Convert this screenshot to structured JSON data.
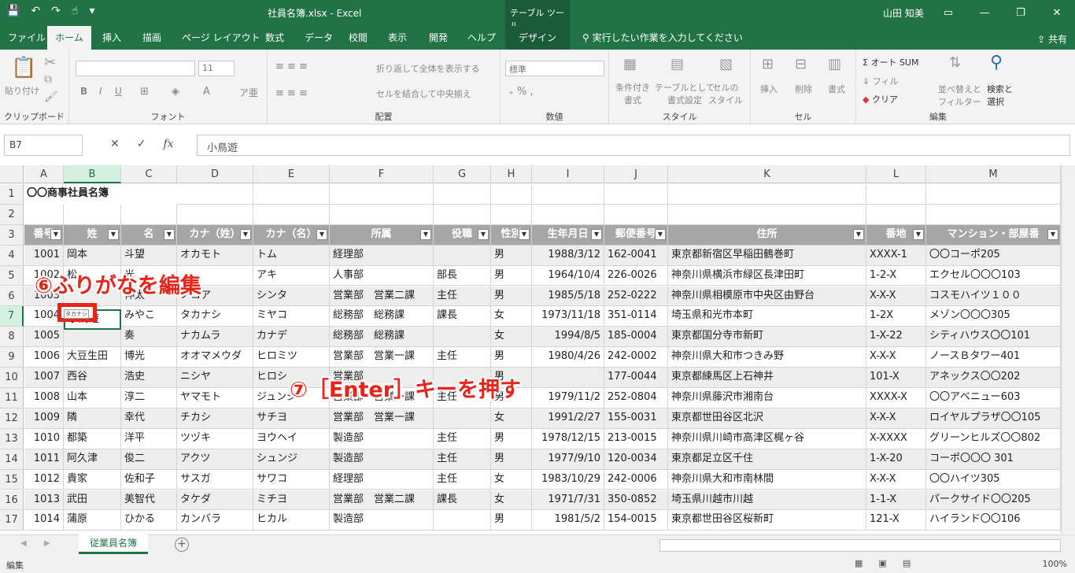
{
  "window": {
    "doc_title": "社員名簿.xlsx  -  Excel",
    "context_title": "テーブル ツール",
    "user": "山田 知美"
  },
  "ribbon_tabs": [
    "ファイル",
    "ホーム",
    "挿入",
    "描画",
    "ページ レイアウト",
    "数式",
    "データ",
    "校閲",
    "表示",
    "開発",
    "ヘルプ",
    "デザイン"
  ],
  "tell_me": "実行したい作業を入力してください",
  "share": "共有",
  "ribbon": {
    "groups": [
      "クリップボード",
      "フォント",
      "配置",
      "数値",
      "スタイル",
      "セル",
      "編集"
    ],
    "paste": "貼り付け",
    "font_size": "11",
    "wrap_text": "折り返して全体を表示する",
    "merge_center": "セルを結合して中央揃え",
    "number_format": "標準",
    "cond_format": "条件付き\n書式",
    "table_format": "テーブルとして\n書式設定",
    "cell_style": "セルの\nスタイル",
    "insert": "挿入",
    "delete": "削除",
    "format": "書式",
    "autosum": "オート SUM",
    "fill": "フィル",
    "clear": "クリア",
    "sort_filter": "並べ替えと\nフィルター",
    "find_select": "検索と\n選択"
  },
  "formula_bar": {
    "name_box": "B7",
    "fx": "fx",
    "content": "小鳥遊"
  },
  "columns": [
    "A",
    "B",
    "C",
    "D",
    "E",
    "F",
    "G",
    "H",
    "I",
    "J",
    "K",
    "L",
    "M"
  ],
  "rows": [
    "1",
    "2",
    "3",
    "4",
    "5",
    "6",
    "7",
    "8",
    "9",
    "10",
    "11",
    "12",
    "13",
    "14",
    "15",
    "16",
    "17"
  ],
  "sheet_title": "〇〇商事社員名簿",
  "table_headers": [
    "番号",
    "姓",
    "名",
    "カナ（姓）",
    "カナ（名）",
    "所属",
    "役職",
    "性別",
    "生年月日",
    "郵便番号",
    "住所",
    "番地",
    "マンション・部屋番"
  ],
  "table_rows": [
    [
      "1001",
      "岡本",
      "斗望",
      "オカモト",
      "トム",
      "経理部",
      "",
      "男",
      "1988/3/12",
      "162-0041",
      "東京都新宿区早稲田鶴巻町",
      "XXXX-1",
      "〇〇コーポ205"
    ],
    [
      "1002",
      "松",
      "光",
      "",
      "アキ",
      "人事部",
      "部長",
      "男",
      "1964/10/4",
      "226-0026",
      "神奈川県横浜市緑区長津田町",
      "1-2-X",
      "エクセル〇〇〇103"
    ],
    [
      "1003",
      "",
      "伸太",
      "ノコア",
      "シンタ",
      "営業部　営業二課",
      "主任",
      "男",
      "1985/5/18",
      "252-0222",
      "神奈川県相模原市中央区由野台",
      "X-X-X",
      "コスモハイツ１００"
    ],
    [
      "1004",
      "",
      "みやこ",
      "タカナシ",
      "ミヤコ",
      "総務部　総務課",
      "課長",
      "女",
      "1973/11/18",
      "351-0114",
      "埼玉県和光市本町",
      "1-2X",
      "メゾン〇〇〇305"
    ],
    [
      "1005",
      "",
      "奏",
      "ナカムラ",
      "カナデ",
      "総務部　総務課",
      "",
      "女",
      "1994/8/5",
      "185-0004",
      "東京都国分寺市新町",
      "1-X-22",
      "シティハウス〇〇101"
    ],
    [
      "1006",
      "大豆生田",
      "博光",
      "オオマメウダ",
      "ヒロミツ",
      "営業部　営業一課",
      "主任",
      "男",
      "1980/4/26",
      "242-0002",
      "神奈川県大和市つきみ野",
      "X-X-X",
      "ノースＢタワー401"
    ],
    [
      "1007",
      "西谷",
      "浩史",
      "ニシヤ",
      "ヒロシ",
      "営業部",
      "",
      "男",
      "",
      "177-0044",
      "東京都練馬区上石神井",
      "101-X",
      "アネックス〇〇202"
    ],
    [
      "1008",
      "山本",
      "淳二",
      "ヤマモト",
      "ジュンジ",
      "営業部　営業一課",
      "主任",
      "男",
      "1979/11/2",
      "252-0804",
      "神奈川県藤沢市湘南台",
      "XXXX-X",
      "〇〇アベニュー603"
    ],
    [
      "1009",
      "隣",
      "幸代",
      "チカシ",
      "サチヨ",
      "営業部　営業一課",
      "",
      "女",
      "1991/2/27",
      "155-0031",
      "東京都世田谷区北沢",
      "X-X-X",
      "ロイヤルプラザ〇〇105"
    ],
    [
      "1010",
      "都築",
      "洋平",
      "ツヅキ",
      "ヨウヘイ",
      "製造部",
      "主任",
      "男",
      "1978/12/15",
      "213-0015",
      "神奈川県川崎市高津区梶ヶ谷",
      "X-XXXX",
      "グリーンヒルズ〇〇802"
    ],
    [
      "1011",
      "阿久津",
      "俊二",
      "アクツ",
      "シュンジ",
      "製造部",
      "主任",
      "男",
      "1977/9/10",
      "120-0034",
      "東京都足立区千住",
      "1-X-20",
      "コーポ〇〇〇 301"
    ],
    [
      "1012",
      "貴家",
      "佐和子",
      "サスガ",
      "サワコ",
      "経理部",
      "主任",
      "女",
      "1983/10/29",
      "242-0006",
      "神奈川県大和市南林間",
      "X-X-X",
      "〇〇ハイツ305"
    ],
    [
      "1013",
      "武田",
      "美智代",
      "タケダ",
      "ミチヨ",
      "営業部　営業二課",
      "課長",
      "女",
      "1971/7/31",
      "350-0852",
      "埼玉県川越市川越",
      "1-1-X",
      "パークサイド〇〇205"
    ],
    [
      "1014",
      "蒲原",
      "ひかる",
      "カンバラ",
      "ヒカル",
      "製造部",
      "",
      "男",
      "1981/5/2",
      "154-0015",
      "東京都世田谷区桜新町",
      "121-X",
      "ハイランド〇〇106"
    ]
  ],
  "editing": {
    "cell_text": "小鳥遊",
    "furigana_box": "タカナシ"
  },
  "annotations": {
    "step6": "⑥ふりがなを編集",
    "step7": "⑦［Enter］キーを押す"
  },
  "sheet_tabs": [
    "従業員名簿"
  ],
  "status": {
    "mode": "編集",
    "zoom": "100%"
  },
  "colors": {
    "excel_green": "#217346",
    "header_gray": "#a6a6a6",
    "band_gray": "#ededed",
    "annotation_red": "#e8241a"
  }
}
